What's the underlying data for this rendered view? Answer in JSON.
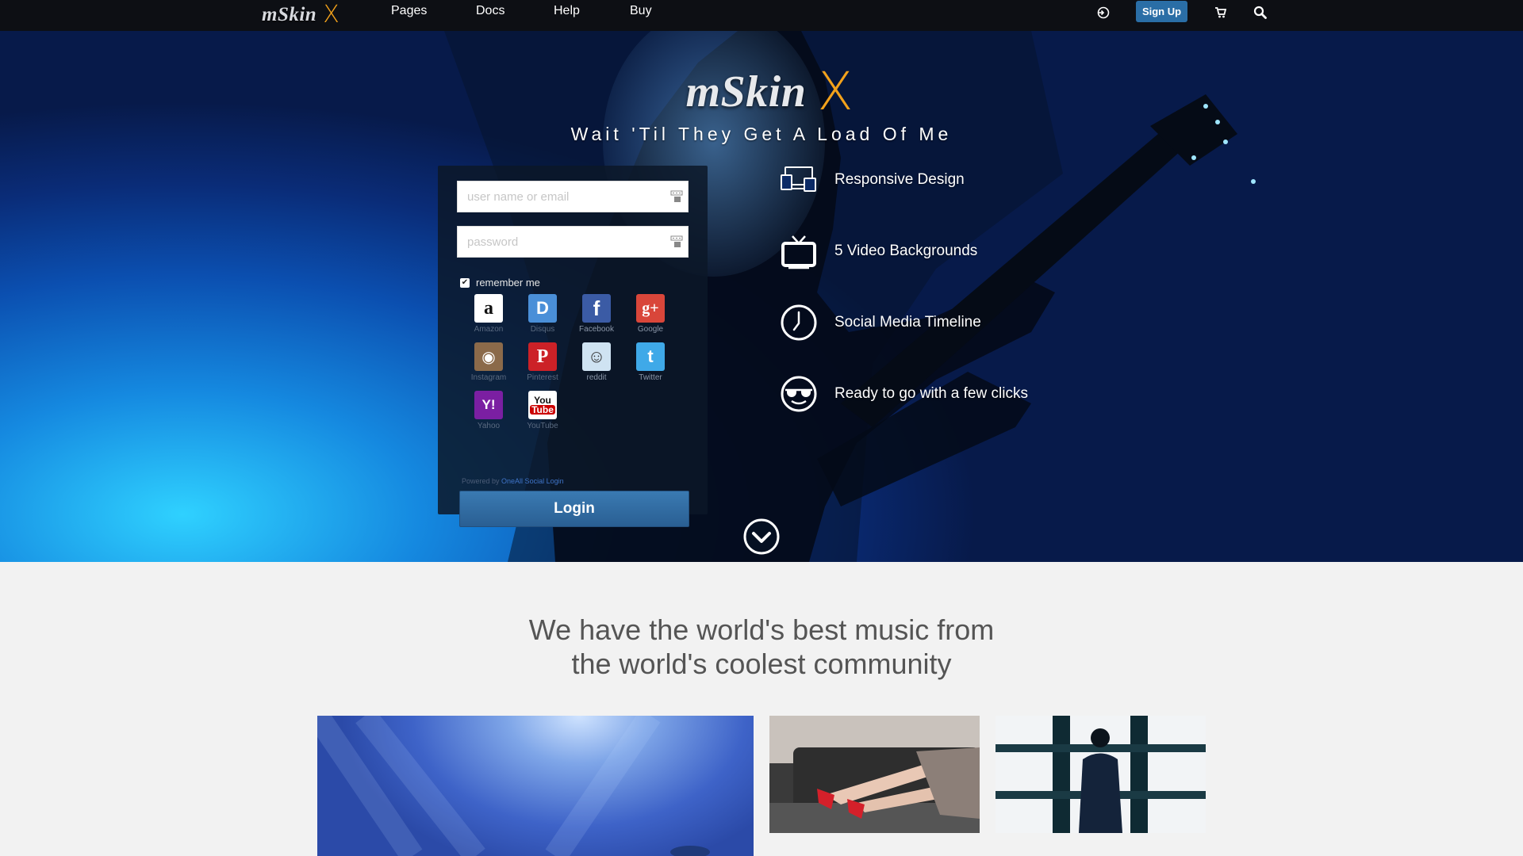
{
  "nav": {
    "logo_text": "mSkin",
    "logo_x": "X",
    "links": [
      "Pages",
      "Docs",
      "Help",
      "Buy"
    ],
    "signup_label": "Sign Up",
    "icons": [
      "login-icon",
      "cart-icon",
      "search-icon"
    ]
  },
  "hero": {
    "logo_text": "mSkin",
    "logo_x": "X",
    "tagline": "Wait 'Til They Get A Load Of Me"
  },
  "login": {
    "username_placeholder": "user name or email",
    "password_placeholder": "password",
    "remember_label": "remember me",
    "remember_checked": true,
    "social": [
      {
        "name": "Amazon",
        "glyph": "a",
        "color": "#ffffff",
        "fg": "#111111"
      },
      {
        "name": "Disqus",
        "glyph": "D",
        "color": "#4a8fd8",
        "fg": "#ffffff"
      },
      {
        "name": "Facebook",
        "glyph": "f",
        "color": "#3b5ba5",
        "fg": "#ffffff"
      },
      {
        "name": "Google",
        "glyph": "g+",
        "color": "#d9463a",
        "fg": "#ffffff"
      },
      {
        "name": "Instagram",
        "glyph": "◉",
        "color": "#8b6a4a",
        "fg": "#ffffff"
      },
      {
        "name": "Pinterest",
        "glyph": "P",
        "color": "#cc2127",
        "fg": "#ffffff"
      },
      {
        "name": "reddit",
        "glyph": "☺",
        "color": "#cfe3f2",
        "fg": "#333333"
      },
      {
        "name": "Twitter",
        "glyph": "t",
        "color": "#3fa9e8",
        "fg": "#ffffff"
      },
      {
        "name": "Yahoo",
        "glyph": "Y!",
        "color": "#7b1fa2",
        "fg": "#ffffff"
      },
      {
        "name": "YouTube",
        "glyph": "You",
        "color": "#ffffff",
        "fg": "#cc0000"
      }
    ],
    "powered_prefix": "Powered by",
    "powered_link": "OneAll Social Login",
    "login_label": "Login"
  },
  "features": [
    {
      "icon": "devices-icon",
      "label": "Responsive Design"
    },
    {
      "icon": "tv-icon",
      "label": "5 Video Backgrounds"
    },
    {
      "icon": "clock-icon",
      "label": "Social Media Timeline"
    },
    {
      "icon": "sunglasses-face-icon",
      "label": "Ready to go with a few clicks"
    }
  ],
  "headline_line1": "We have the world's best music from",
  "headline_line2": "the world's coolest community",
  "colors": {
    "nav_bg": "#0d0f14",
    "accent_orange": "#f3a21b",
    "button_blue": "#2a6ea6"
  }
}
